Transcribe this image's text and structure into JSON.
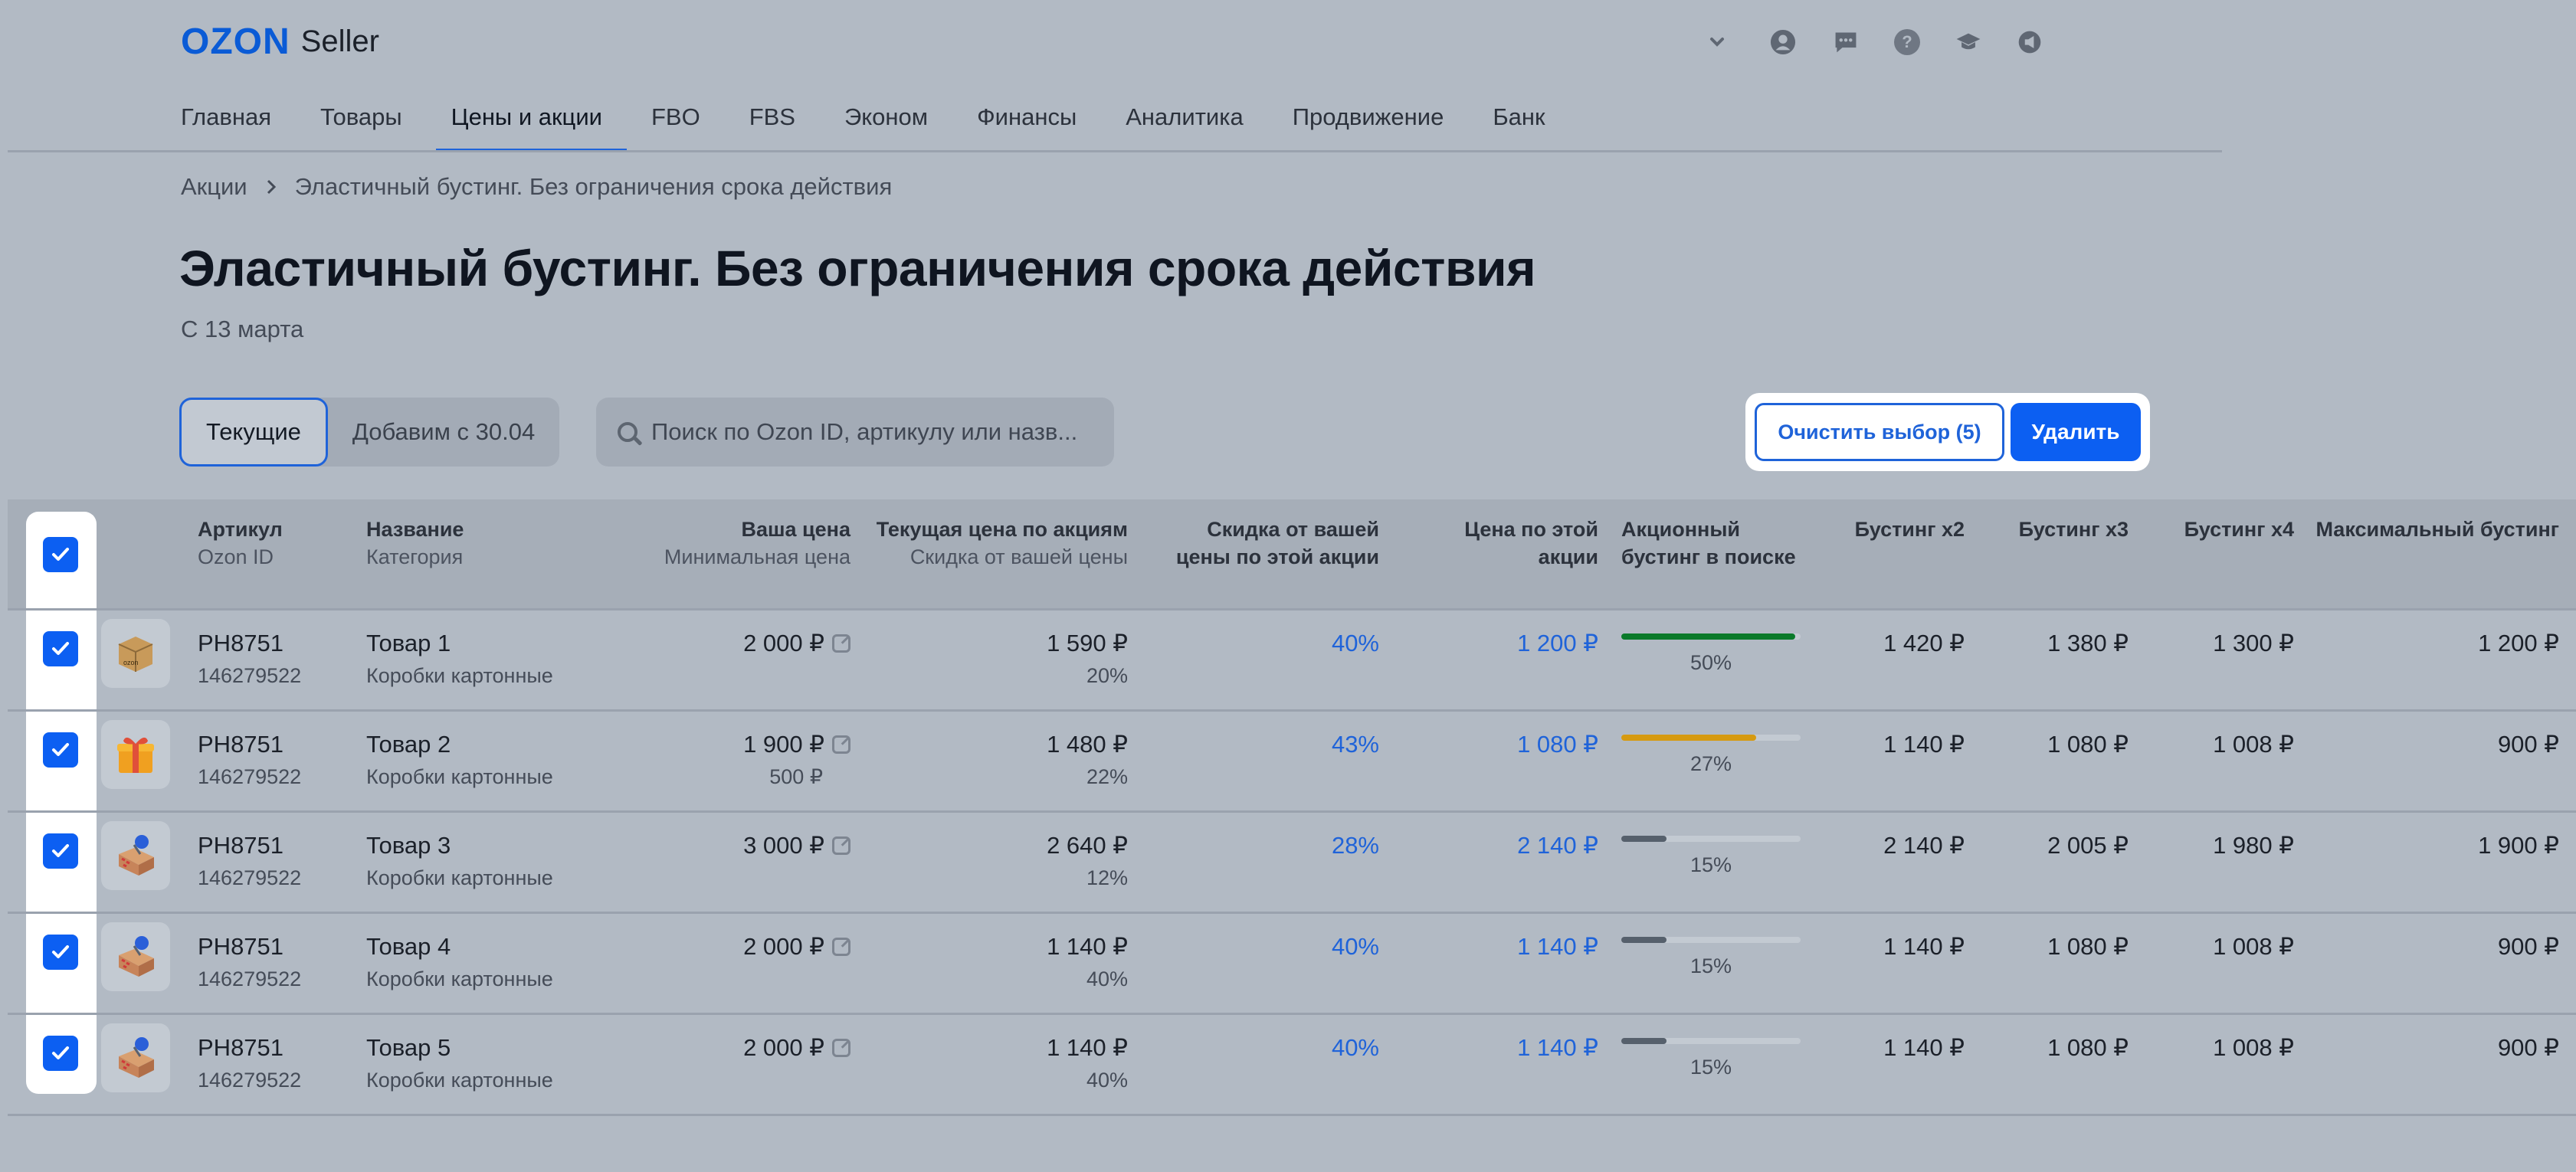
{
  "header": {
    "logo_brand": "OZON",
    "logo_product": "Seller",
    "nav": [
      "Главная",
      "Товары",
      "Цены и акции",
      "FBO",
      "FBS",
      "Эконом",
      "Финансы",
      "Аналитика",
      "Продвижение",
      "Банк"
    ],
    "active_nav": "Цены и акции",
    "icons": [
      "chevron-down-icon",
      "profile-icon",
      "chat-icon",
      "help-icon",
      "education-icon",
      "announcement-icon"
    ]
  },
  "breadcrumb": {
    "root": "Акции",
    "current": "Эластичный бустинг. Без ограничения срока действия"
  },
  "page": {
    "title": "Эластичный бустинг. Без ограничения срока действия",
    "subtitle": "С 13 марта"
  },
  "filters": {
    "tabs": [
      "Текущие",
      "Добавим с 30.04"
    ],
    "active_tab": "Текущие",
    "search_placeholder": "Поиск по Ozon ID, артикулу или назв..."
  },
  "actions": {
    "clear_label": "Очистить выбор (5)",
    "delete_label": "Удалить"
  },
  "table": {
    "columns": {
      "sku": {
        "main": "Артикул",
        "sub": "Ozon ID"
      },
      "name": {
        "main": "Название",
        "sub": "Категория"
      },
      "your_price": {
        "main": "Ваша цена",
        "sub": "Минимальная цена"
      },
      "current_price": {
        "main": "Текущая цена по акциям",
        "sub": "Скидка от вашей цены"
      },
      "discount": {
        "main": "Скидка от вашей",
        "main2": "цены по этой акции"
      },
      "promo_price": {
        "main": "Цена по этой",
        "main2": "акции"
      },
      "promo_boost": {
        "main": "Акционный",
        "main2": "бустинг в поиске"
      },
      "boost2": "Бустинг x2",
      "boost3": "Бустинг x3",
      "boost4": "Бустинг x4",
      "boost_max": "Максимальный бустинг"
    },
    "rows": [
      {
        "sku": "PH8751",
        "ozon_id": "146279522",
        "name": "Товар 1",
        "category": "Коробки картонные",
        "your_price": "2 000 ₽",
        "min_price": "",
        "current_price": "1 590 ₽",
        "current_discount": "20%",
        "discount": "40%",
        "promo_price": "1 200 ₽",
        "boost_pct": "50%",
        "boost_value": 0.97,
        "boost_color": "#0a7a2a",
        "boost2": "1 420 ₽",
        "boost3": "1 380 ₽",
        "boost4": "1 300 ₽",
        "boost_max": "1 200 ₽",
        "thumb": "box-icon",
        "checked": true
      },
      {
        "sku": "PH8751",
        "ozon_id": "146279522",
        "name": "Товар 2",
        "category": "Коробки картонные",
        "your_price": "1 900 ₽",
        "min_price": "500 ₽",
        "current_price": "1 480 ₽",
        "current_discount": "22%",
        "discount": "43%",
        "promo_price": "1 080 ₽",
        "boost_pct": "27%",
        "boost_value": 0.75,
        "boost_color": "#d69a10",
        "boost2": "1 140 ₽",
        "boost3": "1 080 ₽",
        "boost4": "1 008 ₽",
        "boost_max": "900 ₽",
        "thumb": "gift-icon",
        "checked": true
      },
      {
        "sku": "PH8751",
        "ozon_id": "146279522",
        "name": "Товар 3",
        "category": "Коробки картонные",
        "your_price": "3 000 ₽",
        "min_price": "",
        "current_price": "2 640 ₽",
        "current_discount": "12%",
        "discount": "28%",
        "promo_price": "2 140 ₽",
        "boost_pct": "15%",
        "boost_value": 0.25,
        "boost_color": "#56606c",
        "boost2": "2 140 ₽",
        "boost3": "2 005 ₽",
        "boost4": "1 980 ₽",
        "boost_max": "1 900 ₽",
        "thumb": "pinned-box-icon",
        "checked": true
      },
      {
        "sku": "PH8751",
        "ozon_id": "146279522",
        "name": "Товар 4",
        "category": "Коробки картонные",
        "your_price": "2 000 ₽",
        "min_price": "",
        "current_price": "1 140 ₽",
        "current_discount": "40%",
        "discount": "40%",
        "promo_price": "1 140 ₽",
        "boost_pct": "15%",
        "boost_value": 0.25,
        "boost_color": "#56606c",
        "boost2": "1 140 ₽",
        "boost3": "1 080 ₽",
        "boost4": "1 008 ₽",
        "boost_max": "900 ₽",
        "thumb": "pinned-box-icon",
        "checked": true
      },
      {
        "sku": "PH8751",
        "ozon_id": "146279522",
        "name": "Товар 5",
        "category": "Коробки картонные",
        "your_price": "2 000 ₽",
        "min_price": "",
        "current_price": "1 140 ₽",
        "current_discount": "40%",
        "discount": "40%",
        "promo_price": "1 140 ₽",
        "boost_pct": "15%",
        "boost_value": 0.25,
        "boost_color": "#56606c",
        "boost2": "1 140 ₽",
        "boost3": "1 080 ₽",
        "boost4": "1 008 ₽",
        "boost_max": "900 ₽",
        "thumb": "pinned-box-icon",
        "checked": true
      }
    ]
  }
}
